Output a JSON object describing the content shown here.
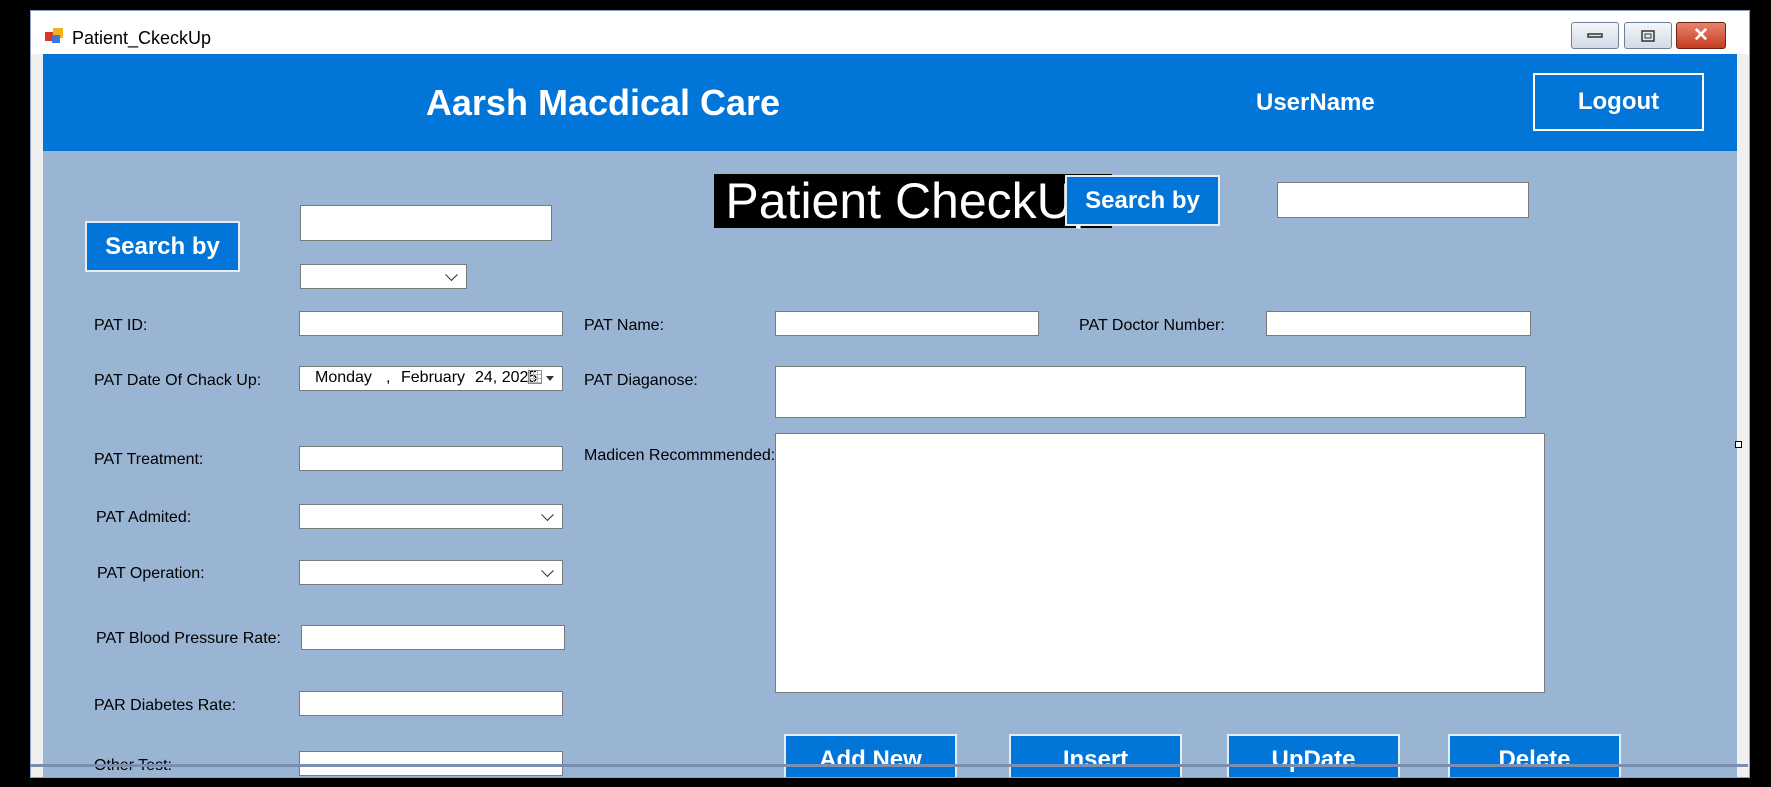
{
  "window": {
    "title": "Patient_CkeckUp",
    "app_icon": "app-icon"
  },
  "header": {
    "brand": "Aarsh Macdical Care",
    "username": "UserName",
    "logout_label": "Logout"
  },
  "page_title": "Patient CheckUp",
  "search": {
    "left_button_label": "Search by",
    "left_input_value": "",
    "left_select_value": "",
    "right_button_label": "Search by",
    "right_input_value": ""
  },
  "form": {
    "pat_id_label": "PAT ID:",
    "pat_id_value": "",
    "pat_name_label": "PAT Name:",
    "pat_name_value": "",
    "pat_doctor_number_label": "PAT Doctor Number:",
    "pat_doctor_number_value": "",
    "date_label": "PAT Date Of Chack Up:",
    "date": {
      "day": "Monday",
      "separator": ",",
      "month": "February",
      "date": "24, 2025"
    },
    "diagnose_label": "PAT Diaganose:",
    "diagnose_value": "",
    "treatment_label": "PAT Treatment:",
    "treatment_value": "",
    "medicine_label": "Madicen Recommmended:",
    "medicine_value": "",
    "admitted_label": "PAT Admited:",
    "admitted_value": "",
    "operation_label": "PAT Operation:",
    "operation_value": "",
    "blood_pressure_label": "PAT Blood Pressure Rate:",
    "blood_pressure_value": "",
    "diabetes_label": "PAR Diabetes Rate:",
    "diabetes_value": "",
    "other_test_label": "Other Test:",
    "other_test_value": ""
  },
  "actions": {
    "add_new": "Add New",
    "insert": "Insert",
    "update": "UpDate",
    "delete": "Delete"
  }
}
